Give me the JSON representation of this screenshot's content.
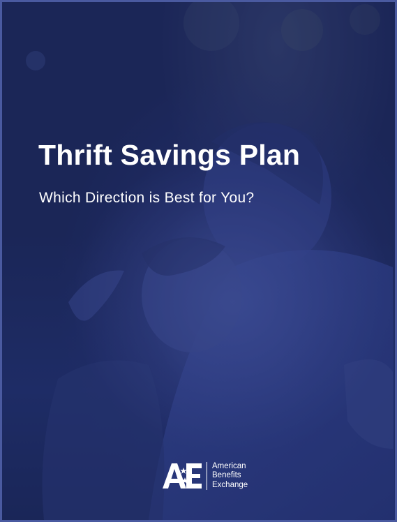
{
  "cover": {
    "title": "Thrift Savings Plan",
    "subtitle": "Which Direction is Best for You?"
  },
  "logo": {
    "mark": "AE",
    "line1": "American",
    "line2": "Benefits",
    "line3": "Exchange"
  },
  "colors": {
    "background": "#1d2757",
    "border": "#4a5aa0",
    "text": "#ffffff"
  }
}
